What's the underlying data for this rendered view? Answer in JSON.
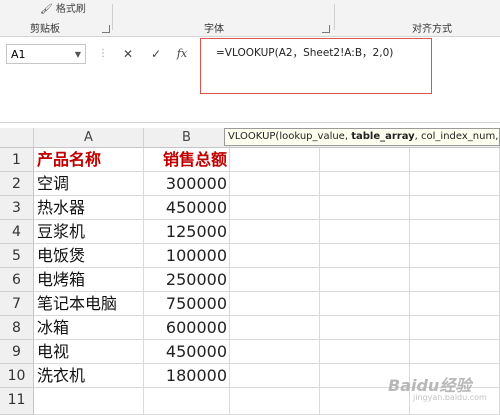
{
  "ribbon": {
    "format_painter": "格式刷",
    "groups": [
      "剪贴板",
      "字体",
      "对齐方式"
    ]
  },
  "formula_bar": {
    "name_box": "A1",
    "cancel_icon": "✕",
    "enter_icon": "✓",
    "fx_icon": "fx",
    "formula": "=VLOOKUP(A2，Sheet2!A:B，2,0)"
  },
  "tooltip": {
    "prefix": "VLOOKUP(lookup_value, ",
    "bold": "table_array",
    "suffix": ", col_index_num, [ran"
  },
  "columns": [
    "A",
    "B"
  ],
  "rows": [
    {
      "num": "1",
      "a": "产品名称",
      "b": "销售总额",
      "header": true
    },
    {
      "num": "2",
      "a": "空调",
      "b": "300000"
    },
    {
      "num": "3",
      "a": "热水器",
      "b": "450000"
    },
    {
      "num": "4",
      "a": "豆浆机",
      "b": "125000"
    },
    {
      "num": "5",
      "a": "电饭煲",
      "b": "100000"
    },
    {
      "num": "6",
      "a": "电烤箱",
      "b": "250000"
    },
    {
      "num": "7",
      "a": "笔记本电脑",
      "b": "750000"
    },
    {
      "num": "8",
      "a": "冰箱",
      "b": "600000"
    },
    {
      "num": "9",
      "a": "电视",
      "b": "450000"
    },
    {
      "num": "10",
      "a": "洗衣机",
      "b": "180000"
    },
    {
      "num": "11",
      "a": "",
      "b": ""
    }
  ],
  "watermark": {
    "text": "Baidu经验",
    "sub": "jingyan.baidu.com"
  },
  "colors": {
    "header_text": "#c00000",
    "highlight_box": "#d9534f"
  }
}
